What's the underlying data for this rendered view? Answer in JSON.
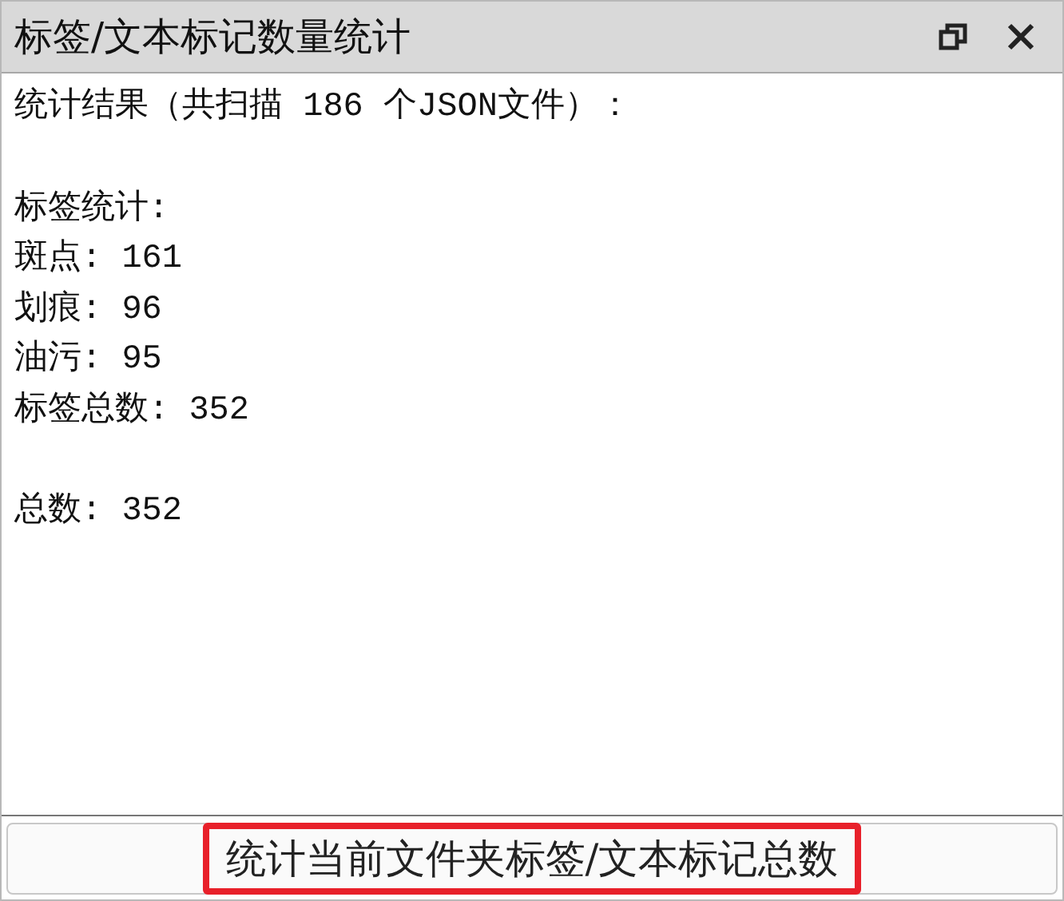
{
  "window": {
    "title": "标签/文本标记数量统计"
  },
  "output": {
    "sections": [
      {
        "lines": [
          "统计结果（共扫描 186 个JSON文件）："
        ]
      },
      {
        "lines": [
          "标签统计:",
          "斑点: 161",
          "划痕: 96",
          "油污: 95",
          "标签总数: 352"
        ]
      },
      {
        "lines": [
          "总数: 352"
        ]
      }
    ]
  },
  "button": {
    "label": "统计当前文件夹标签/文本标记总数",
    "highlighted": true
  }
}
